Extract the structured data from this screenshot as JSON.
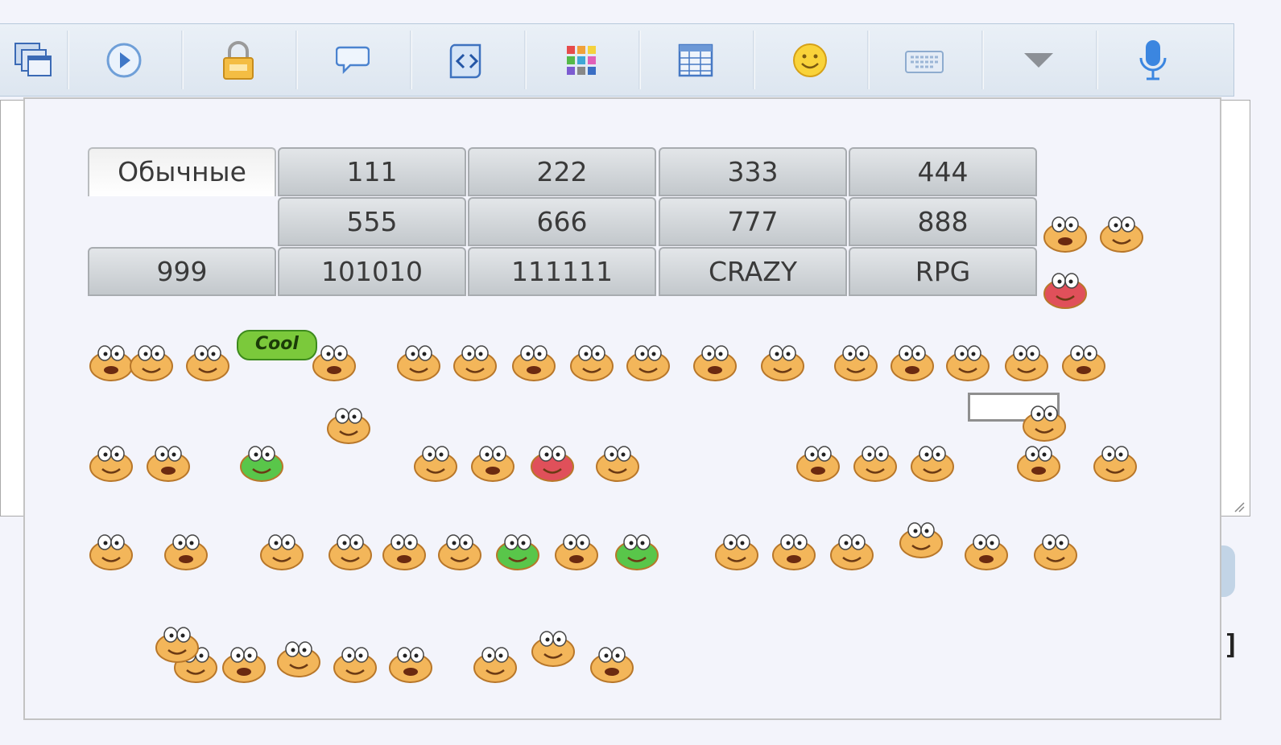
{
  "toolbar": {
    "buttons": [
      {
        "name": "windows-icon"
      },
      {
        "name": "play-icon"
      },
      {
        "name": "lock-icon"
      },
      {
        "name": "speech-bubble-icon"
      },
      {
        "name": "code-scroll-icon"
      },
      {
        "name": "color-grid-icon"
      },
      {
        "name": "table-icon"
      },
      {
        "name": "smiley-icon"
      },
      {
        "name": "keyboard-icon"
      },
      {
        "name": "dropdown-triangle-icon"
      },
      {
        "name": "microphone-icon"
      }
    ]
  },
  "smiley_panel": {
    "tabs": [
      {
        "label": "Обычные",
        "active": true
      },
      {
        "label": "111"
      },
      {
        "label": "222"
      },
      {
        "label": "333"
      },
      {
        "label": "444"
      },
      {
        "label": "555"
      },
      {
        "label": "666"
      },
      {
        "label": "777"
      },
      {
        "label": "888"
      },
      {
        "label": "999"
      },
      {
        "label": "101010"
      },
      {
        "label": "111111"
      },
      {
        "label": "CRAZY"
      },
      {
        "label": "RPG"
      }
    ],
    "cool_tag": "Cool",
    "smiley_count": 60
  },
  "colors": {
    "smiley_body": "#f3b65a",
    "smiley_green": "#59c64a",
    "smiley_red": "#e0505a",
    "toolbar_bg": "#e3ebf5",
    "tab_bg": "#c9ced2"
  }
}
